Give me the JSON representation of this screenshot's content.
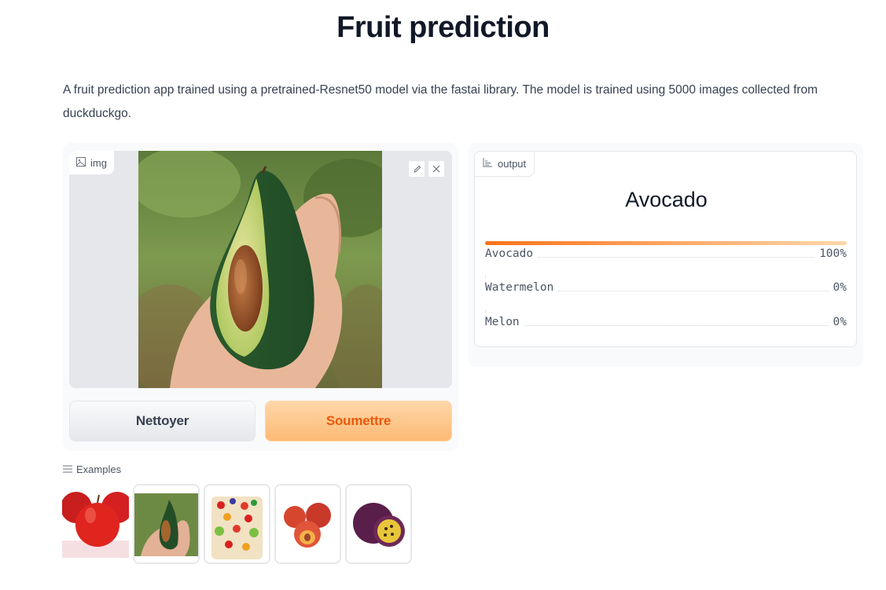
{
  "header": {
    "title": "Fruit prediction",
    "description": "A fruit prediction app trained using a pretrained-Resnet50 model via the fastai library. The model is trained using 5000 images collected from duckduckgo."
  },
  "input": {
    "label": "img",
    "icon": "image-icon",
    "edit_icon": "pencil-icon",
    "close_icon": "close-icon"
  },
  "buttons": {
    "clear_label": "Nettoyer",
    "submit_label": "Soumettre"
  },
  "output": {
    "label": "output",
    "icon": "bar-chart-icon",
    "prediction": "Avocado",
    "confidences": [
      {
        "label": "Avocado",
        "value_text": "100%",
        "value": 1.0
      },
      {
        "label": "Watermelon",
        "value_text": "0%",
        "value": 0.0
      },
      {
        "label": "Melon",
        "value_text": "0%",
        "value": 0.0
      }
    ]
  },
  "examples": {
    "label": "Examples",
    "icon": "list-icon",
    "items": [
      "apples",
      "avocado",
      "fruit-cake",
      "peaches",
      "passion-fruit"
    ]
  },
  "colors": {
    "accent": "#f97316",
    "submit_bg": "#fdba74",
    "submit_text": "#ea580c"
  }
}
